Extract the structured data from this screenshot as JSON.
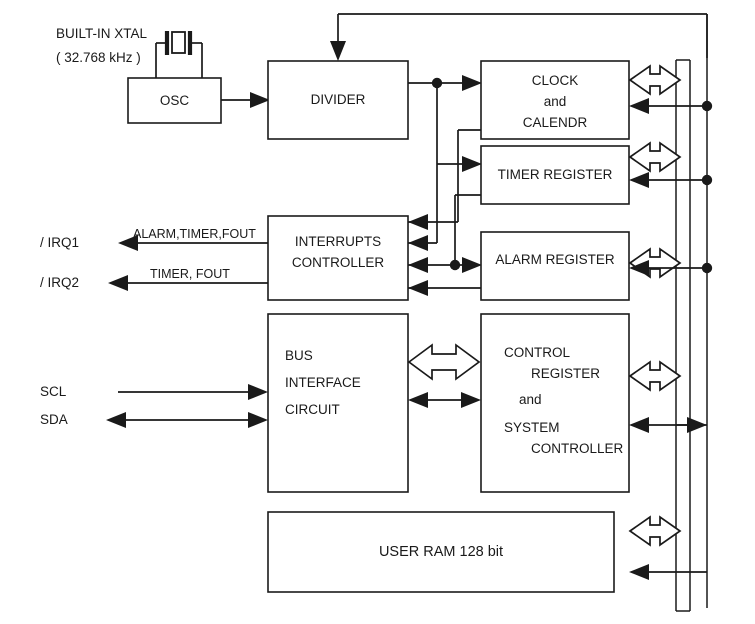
{
  "diagram": {
    "title": "RTC block diagram",
    "line_color": "#1a1a1a",
    "background": "#ffffff"
  },
  "annotations": {
    "xtal_name": "BUILT-IN XTAL",
    "xtal_freq": "( 32.768 kHz )",
    "irq1": "/ IRQ1",
    "irq2": "/ IRQ2",
    "irq1_sources": "ALARM,TIMER,FOUT",
    "irq2_sources": "TIMER, FOUT",
    "scl": "SCL",
    "sda": "SDA"
  },
  "blocks": {
    "osc": {
      "label": "OSC"
    },
    "divider": {
      "label": "DIVIDER"
    },
    "clock": {
      "line1": "CLOCK",
      "line2": "and",
      "line3": "CALENDR"
    },
    "timer_register": {
      "label": "TIMER REGISTER"
    },
    "alarm_register": {
      "label": "ALARM REGISTER"
    },
    "interrupts": {
      "line1": "INTERRUPTS",
      "line2": "CONTROLLER"
    },
    "bus_interface": {
      "line1": "BUS",
      "line2": "INTERFACE",
      "line3": "CIRCUIT"
    },
    "control": {
      "line1": "CONTROL",
      "line2": "REGISTER",
      "line3": "and",
      "line4": "SYSTEM",
      "line5": "CONTROLLER"
    },
    "user_ram": {
      "label": "USER RAM 128 bit"
    }
  }
}
